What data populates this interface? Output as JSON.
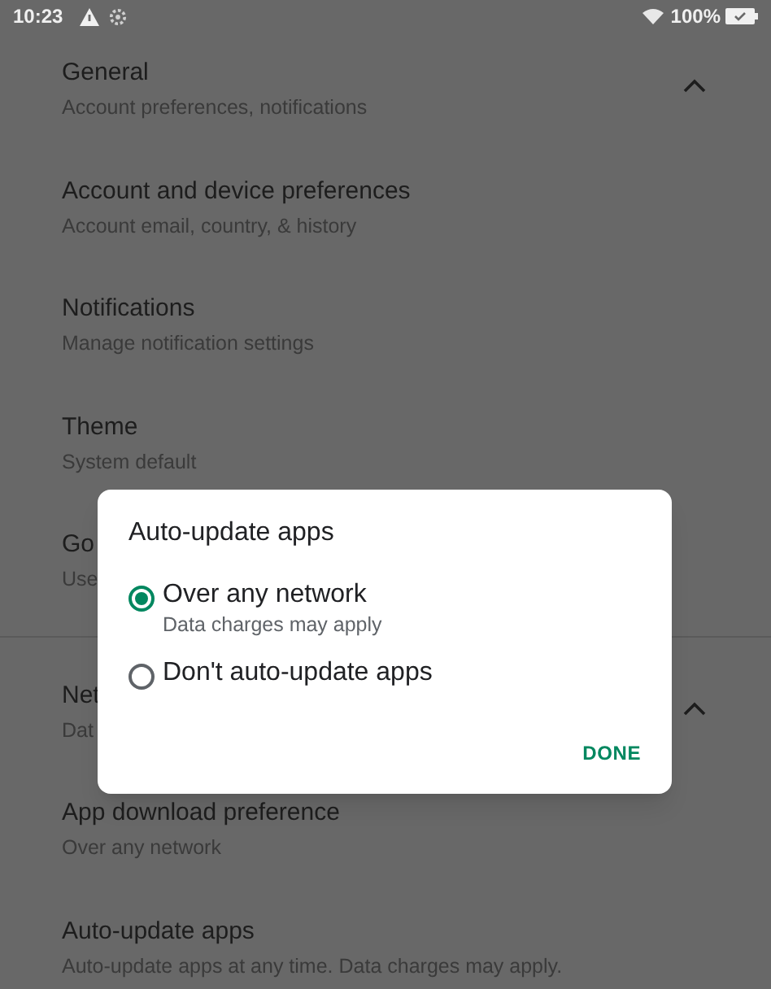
{
  "status_bar": {
    "time": "10:23",
    "battery": "100%"
  },
  "sections": [
    {
      "header": {
        "title": "General",
        "subtitle": "Account preferences, notifications",
        "expanded": true
      },
      "items": [
        {
          "title": "Account and device preferences",
          "subtitle": "Account email, country, & history"
        },
        {
          "title": "Notifications",
          "subtitle": "Manage notification settings"
        },
        {
          "title": "Theme",
          "subtitle": "System default"
        },
        {
          "title": "Go",
          "subtitle": "Use"
        }
      ]
    },
    {
      "header": {
        "title": "Net",
        "subtitle": "Dat",
        "expanded": true
      },
      "items": [
        {
          "title": "App download preference",
          "subtitle": "Over any network"
        },
        {
          "title": "Auto-update apps",
          "subtitle": "Auto-update apps at any time. Data charges may apply."
        }
      ]
    }
  ],
  "dialog": {
    "title": "Auto-update apps",
    "options": [
      {
        "label": "Over any network",
        "subtitle": "Data charges may apply",
        "selected": true
      },
      {
        "label": "Don't auto-update apps",
        "selected": false
      }
    ],
    "button": "DONE"
  }
}
